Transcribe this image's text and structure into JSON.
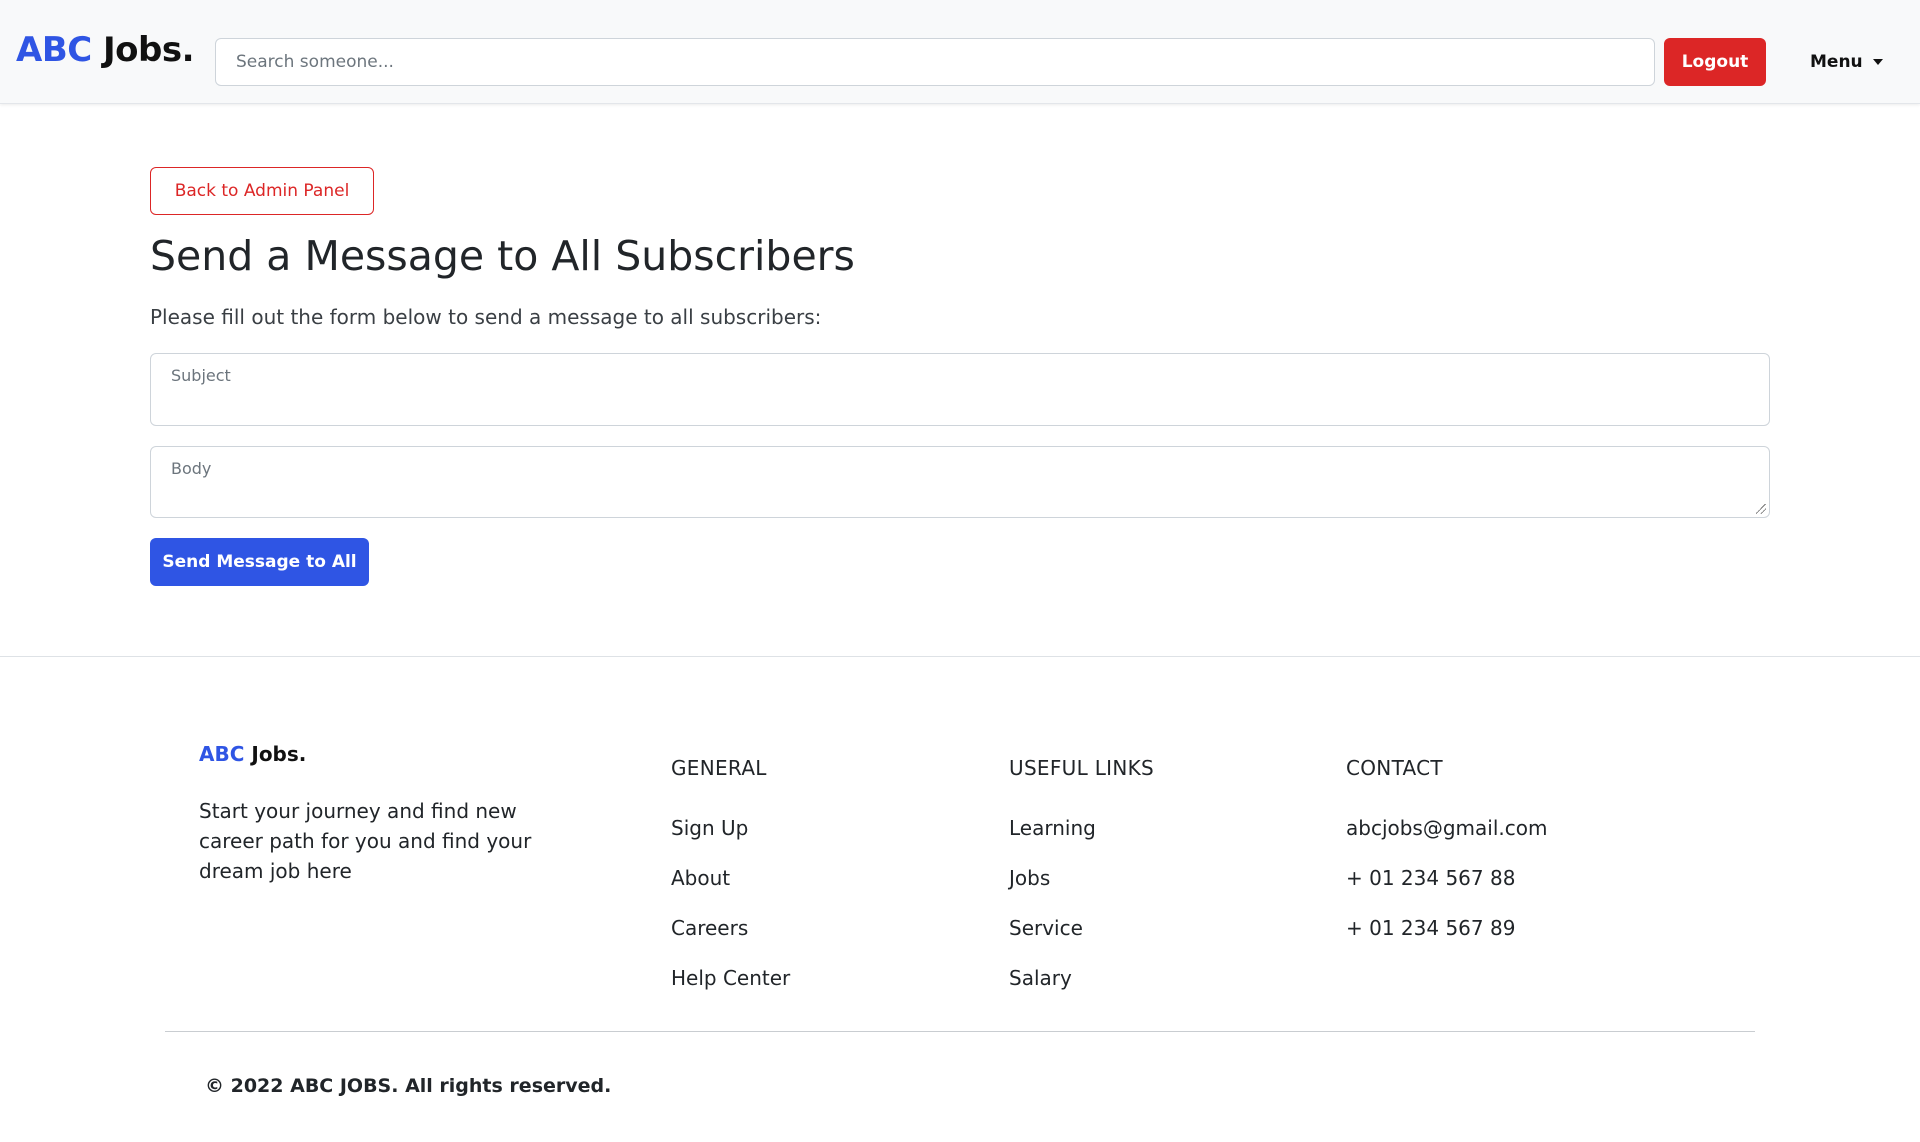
{
  "navbar": {
    "brand_abc": "ABC",
    "brand_jobs": "Jobs.",
    "search_placeholder": "Search someone...",
    "logout_label": "Logout",
    "menu_label": "Menu"
  },
  "main": {
    "back_label": "Back to Admin Panel",
    "title": "Send a Message to All Subscribers",
    "lead": "Please fill out the form below to send a message to all subscribers:",
    "subject_label": "Subject",
    "body_label": "Body",
    "send_label": "Send Message to All"
  },
  "footer": {
    "brand_abc": "ABC",
    "brand_jobs": "Jobs.",
    "description": "Start your journey and find new career path for you and find your dream job here",
    "general": {
      "heading": "GENERAL",
      "links": [
        "Sign Up",
        "About",
        "Careers",
        "Help Center"
      ]
    },
    "useful": {
      "heading": "USEFUL LINKS",
      "links": [
        "Learning",
        "Jobs",
        "Service",
        "Salary"
      ]
    },
    "contact": {
      "heading": "CONTACT",
      "items": [
        "abcjobs@gmail.com",
        "+ 01 234 567 88",
        "+ 01 234 567 89"
      ]
    },
    "copyright": "© 2022 ABC JOBS. All rights reserved."
  },
  "colors": {
    "brand_blue": "#2f55e4",
    "danger_red": "#dc2626"
  }
}
